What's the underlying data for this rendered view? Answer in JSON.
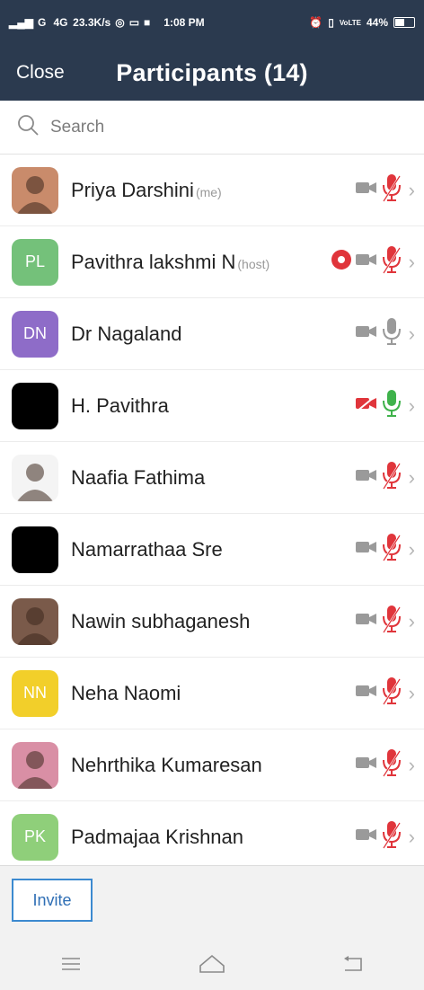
{
  "status_bar": {
    "left": "G   4G  23.3K/s",
    "time": "1:08 PM",
    "battery": "44%"
  },
  "header": {
    "close_label": "Close",
    "title": "Participants (14)"
  },
  "search": {
    "placeholder": "Search",
    "icon": "search-icon"
  },
  "participants": [
    {
      "name": "Priya Darshini",
      "role": "(me)",
      "avatar_type": "photo",
      "avatar_color": "#c98b6b",
      "video": "off",
      "audio": "muted",
      "recording": false
    },
    {
      "name": "Pavithra lakshmi N",
      "role": "(host)",
      "initials": "PL",
      "avatar_color": "#74c17a",
      "video": "off",
      "audio": "muted",
      "recording": true
    },
    {
      "name": "Dr Nagaland",
      "role": "",
      "initials": "DN",
      "avatar_color": "#8e6cc8",
      "video": "off",
      "audio": "on",
      "recording": false
    },
    {
      "name": "H. Pavithra",
      "role": "",
      "avatar_type": "photo",
      "avatar_color": "#000000",
      "video": "off-red",
      "audio": "active",
      "recording": false
    },
    {
      "name": "Naafia Fathima",
      "role": "",
      "avatar_type": "photo",
      "avatar_color": "#f4f4f4",
      "video": "off",
      "audio": "muted",
      "recording": false
    },
    {
      "name": "Namarrathaa Sre",
      "role": "",
      "avatar_type": "photo",
      "avatar_color": "#000000",
      "video": "off",
      "audio": "muted",
      "recording": false
    },
    {
      "name": "Nawin subhaganesh",
      "role": "",
      "avatar_type": "photo",
      "avatar_color": "#7a5a4a",
      "video": "off",
      "audio": "muted",
      "recording": false
    },
    {
      "name": "Neha Naomi",
      "role": "",
      "initials": "NN",
      "avatar_color": "#f2cf2a",
      "video": "off",
      "audio": "muted",
      "recording": false
    },
    {
      "name": "Nehrthika Kumaresan",
      "role": "",
      "avatar_type": "photo",
      "avatar_color": "#d98fa5",
      "video": "off",
      "audio": "muted",
      "recording": false
    },
    {
      "name": "Padmajaa Krishnan",
      "role": "",
      "initials": "PK",
      "avatar_color": "#8fcf7a",
      "video": "off",
      "audio": "muted",
      "recording": false
    }
  ],
  "footer": {
    "invite_label": "Invite"
  },
  "nav": {
    "items": [
      "menu-icon",
      "home-icon",
      "back-icon"
    ]
  },
  "colors": {
    "header_bg": "#2b3a4f",
    "muted_red": "#e0353b",
    "active_green": "#3fb24b",
    "icon_gray": "#9a9a9a"
  }
}
